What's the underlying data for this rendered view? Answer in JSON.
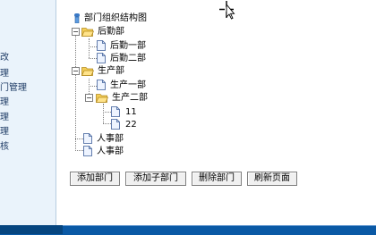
{
  "sidebar": {
    "items": [
      {
        "label": "改"
      },
      {
        "label": "理"
      },
      {
        "label": "门管理"
      },
      {
        "label": "理"
      },
      {
        "label": "理"
      },
      {
        "label": "理"
      },
      {
        "label": "核"
      }
    ]
  },
  "tree": {
    "title": "部门组织结构图",
    "nodes": {
      "houqin": "后勤部",
      "houqin1": "后勤一部",
      "houqin2": "后勤二部",
      "shengchan": "生产部",
      "shengchan1": "生产一部",
      "shengchan2": "生产二部",
      "n11": "11",
      "n22": "22",
      "renshi_a": "人事部",
      "renshi_b": "人事部"
    },
    "toggles": {
      "expanded": "−"
    }
  },
  "actions": {
    "add_dept": "添加部门",
    "add_sub_dept": "添加子部门",
    "delete_dept": "删除部门",
    "refresh": "刷新页面"
  },
  "colors": {
    "sidebar_bg": "#eaf3fb",
    "taskbar": "#0a59a5",
    "folder": "#f5cf57"
  }
}
